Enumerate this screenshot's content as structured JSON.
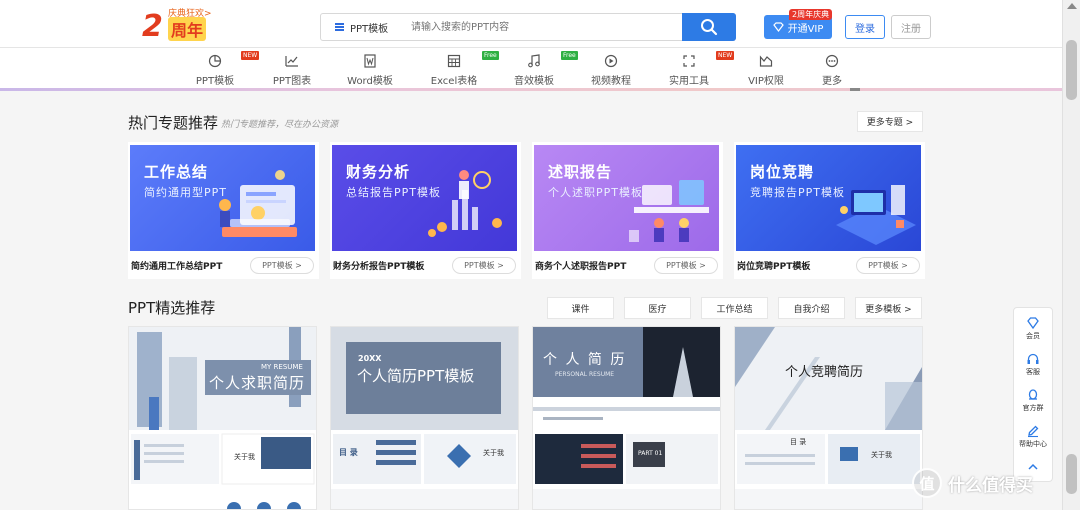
{
  "header": {
    "logo_top": "庆典狂欢>",
    "logo_big": "2",
    "logo_nian": "周年",
    "search": {
      "type_label": "PPT模板",
      "placeholder": "请输入搜索的PPT内容"
    },
    "vip_badge": "2周年庆典",
    "vip_label": "开通VIP",
    "login": "登录",
    "register": "注册"
  },
  "nav": [
    {
      "label": "PPT模板",
      "icon": "pie-chart-icon",
      "tag": "NEW"
    },
    {
      "label": "PPT图表",
      "icon": "line-chart-icon",
      "tag": ""
    },
    {
      "label": "Word模板",
      "icon": "word-doc-icon",
      "tag": ""
    },
    {
      "label": "Excel表格",
      "icon": "table-icon",
      "tag": "Free"
    },
    {
      "label": "音效模板",
      "icon": "music-note-icon",
      "tag": "Free"
    },
    {
      "label": "视频教程",
      "icon": "play-icon",
      "tag": ""
    },
    {
      "label": "实用工具",
      "icon": "tool-icon",
      "tag": "NEW"
    },
    {
      "label": "VIP权限",
      "icon": "crown-icon",
      "tag": ""
    },
    {
      "label": "更多",
      "icon": "more-icon",
      "tag": ""
    }
  ],
  "hot_topics": {
    "title": "热门专题推荐",
    "subtitle": "热门专题推荐，尽在办公资源",
    "more": "更多专题 >",
    "cards": [
      {
        "heading": "工作总结",
        "sub": "简约通用型PPT",
        "name": "简约通用工作总结PPT",
        "btn": "PPT模板 >",
        "color1": "#4f6ef7",
        "color2": "#3a5df0"
      },
      {
        "heading": "财务分析",
        "sub": "总结报告PPT模板",
        "name": "财务分析报告PPT模板",
        "btn": "PPT模板 >",
        "color1": "#5a4de8",
        "color2": "#4a3fe0"
      },
      {
        "heading": "述职报告",
        "sub": "个人述职PPT模板",
        "name": "商务个人述职报告PPT",
        "btn": "PPT模板 >",
        "color1": "#b07af0",
        "color2": "#9a66ea"
      },
      {
        "heading": "岗位竞聘",
        "sub": "竞聘报告PPT模板",
        "name": "岗位竞聘PPT模板",
        "btn": "PPT模板 >",
        "color1": "#3b6df0",
        "color2": "#2f4fe0"
      }
    ]
  },
  "featured": {
    "title": "PPT精选推荐",
    "filters": [
      "课件",
      "医疗",
      "工作总结",
      "自我介绍",
      "更多模板 >"
    ],
    "templates": [
      {
        "title": "个人求职简历",
        "en": "MY RESUME",
        "accent": "#6f8fb5"
      },
      {
        "title": "个人简历PPT模板",
        "en": "20XX",
        "accent": "#6d7f9a"
      },
      {
        "title": "个 人 简 历",
        "en": "PERSONAL RESUME",
        "accent": "#6f819e"
      },
      {
        "title": "个人竞聘简历",
        "en": "",
        "accent": "#8a9bb6"
      }
    ],
    "thumb_labels": [
      "关于我",
      "目 录",
      "关于我",
      "PART 01",
      "目 录",
      "关于我"
    ]
  },
  "side_toolbar": [
    {
      "label": "会员",
      "icon": "diamond-icon"
    },
    {
      "label": "客服",
      "icon": "headset-icon"
    },
    {
      "label": "官方群",
      "icon": "qq-icon"
    },
    {
      "label": "帮助中心",
      "icon": "pen-icon"
    },
    {
      "label": "",
      "icon": "chevron-up-icon"
    }
  ],
  "watermark": {
    "glyph": "值",
    "text": "什么值得买"
  }
}
